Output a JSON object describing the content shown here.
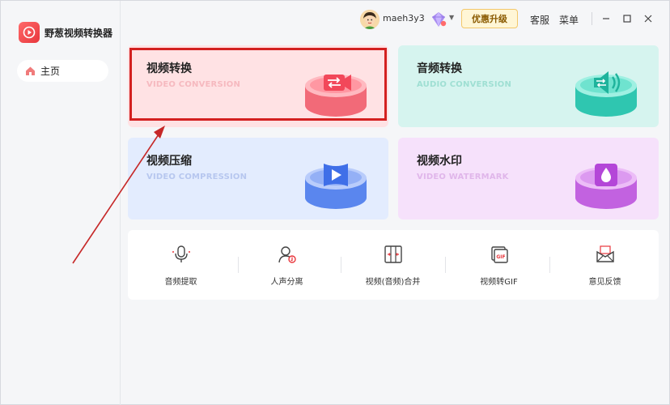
{
  "app": {
    "title": "野葱视频转换器"
  },
  "sidebar": {
    "items": [
      {
        "label": "主页",
        "icon": "home-icon"
      }
    ]
  },
  "titlebar": {
    "username": "maeh3y3",
    "promo_label": "优惠升级",
    "service_label": "客服",
    "menu_label": "菜单"
  },
  "cards": [
    {
      "title": "视频转换",
      "subtitle": "VIDEO CONVERSION",
      "icon": "convert-icon"
    },
    {
      "title": "音频转换",
      "subtitle": "AUDIO CONVERSION",
      "icon": "audio-icon"
    },
    {
      "title": "视频压缩",
      "subtitle": "VIDEO COMPRESSION",
      "icon": "compress-icon"
    },
    {
      "title": "视频水印",
      "subtitle": "VIDEO WATERMARK",
      "icon": "watermark-icon"
    }
  ],
  "tools": [
    {
      "label": "音频提取",
      "icon": "microphone-icon"
    },
    {
      "label": "人声分离",
      "icon": "voice-separation-icon"
    },
    {
      "label": "视频(音频)合并",
      "icon": "merge-icon"
    },
    {
      "label": "视频转GIF",
      "icon": "gif-icon"
    },
    {
      "label": "意见反馈",
      "icon": "feedback-icon"
    }
  ],
  "colors": {
    "accent": "#e8363c",
    "highlight": "#d32020",
    "video_card": "#ffe2e4",
    "audio_card": "#d6f4ef",
    "compress_card": "#e3ecfe",
    "watermark_card": "#f6e1fb"
  }
}
